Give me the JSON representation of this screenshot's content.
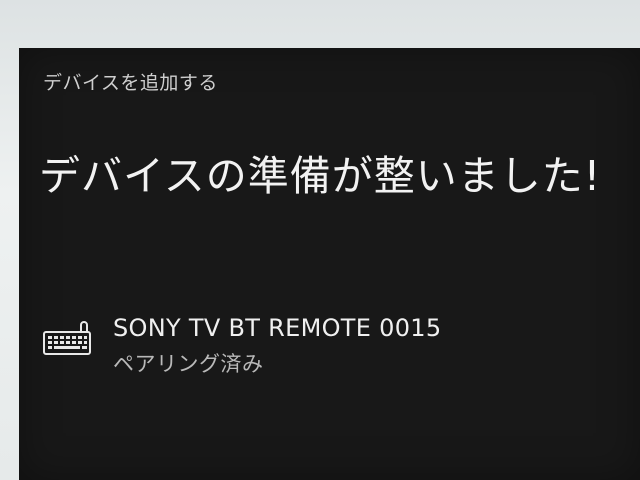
{
  "dialog": {
    "header": "デバイスを追加する",
    "title": "デバイスの準備が整いました!"
  },
  "device": {
    "icon": "keyboard-icon",
    "name": "SONY TV BT REMOTE 0015",
    "status": "ペアリング済み"
  },
  "colors": {
    "dialog_background": "#181818",
    "title_text": "#f2f2f2",
    "secondary_text": "#b9b9b9",
    "backdrop": "#e9ecec"
  }
}
